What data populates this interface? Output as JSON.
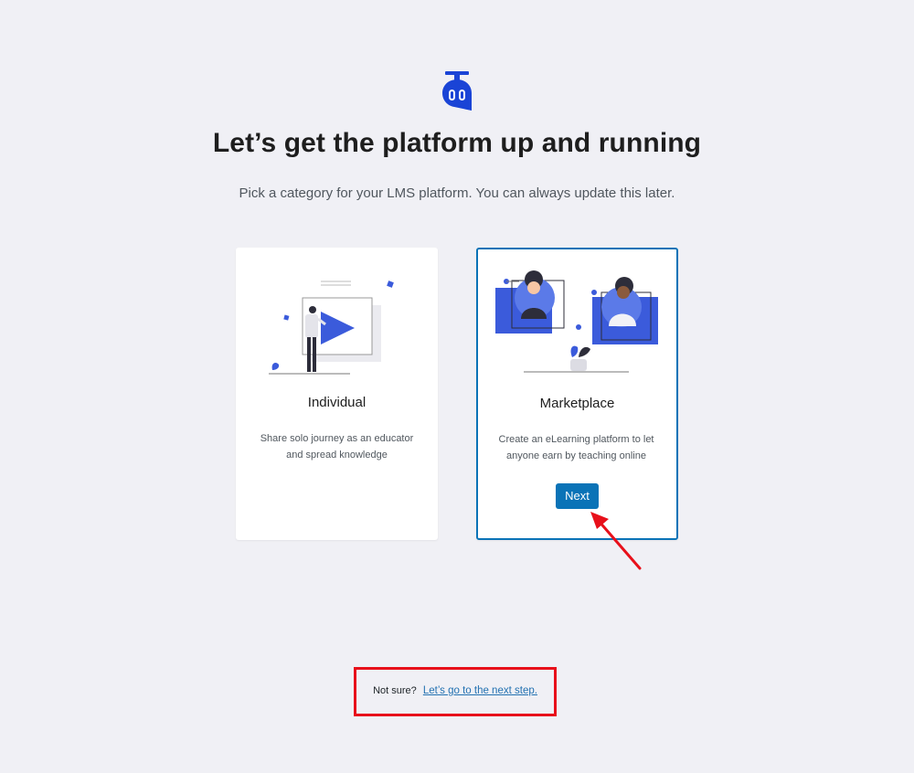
{
  "header": {
    "title": "Let’s get the platform up and running",
    "subtitle": "Pick a category for your LMS platform. You can always update this later."
  },
  "cards": [
    {
      "title": "Individual",
      "description": "Share solo journey as an educator and spread knowledge",
      "selected": false
    },
    {
      "title": "Marketplace",
      "description": "Create an eLearning platform to let anyone earn by teaching online",
      "selected": true,
      "button_label": "Next"
    }
  ],
  "footer": {
    "prompt": "Not sure?",
    "link": "Let’s go to the next step."
  },
  "colors": {
    "accent": "#0a73b7",
    "illustration_blue": "#3b5bdb",
    "annotation_red": "#e8101a"
  }
}
